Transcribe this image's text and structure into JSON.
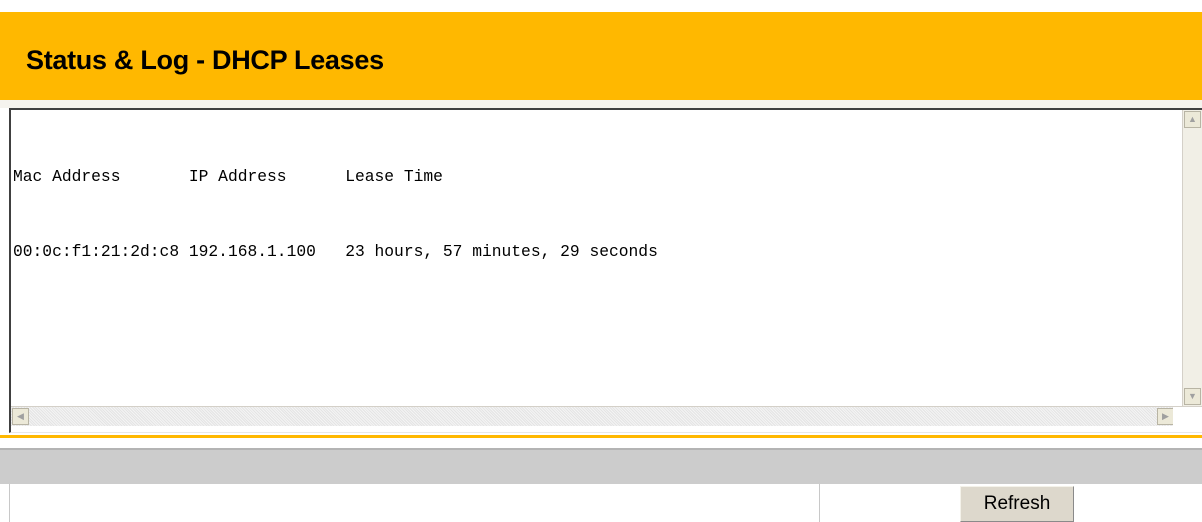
{
  "header": {
    "title": "Status & Log - DHCP Leases",
    "background_color": "#FFB800"
  },
  "leases": {
    "lines": [
      "Mac Address       IP Address      Lease Time",
      "00:0c:f1:21:2d:c8 192.168.1.100   23 hours, 57 minutes, 29 seconds"
    ]
  },
  "scrollbar": {
    "up_icon": "▲",
    "down_icon": "▼",
    "left_icon": "◀",
    "right_icon": "▶"
  },
  "actions": {
    "refresh_label": "Refresh"
  }
}
